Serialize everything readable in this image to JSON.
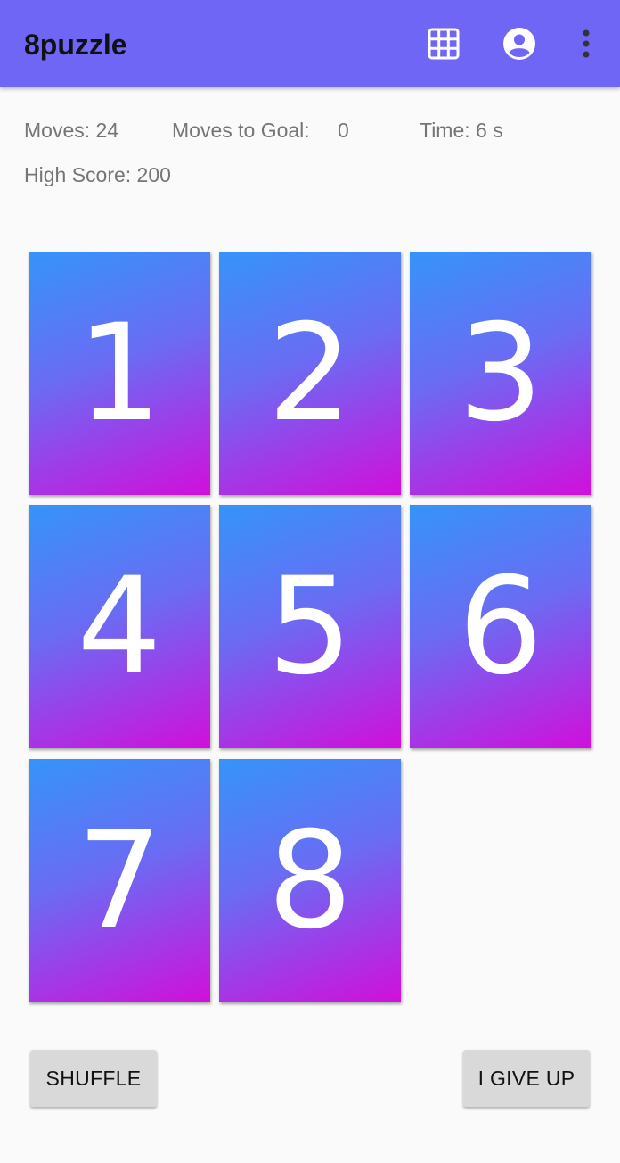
{
  "app": {
    "title": "8puzzle",
    "bar_color": "#6f66f5"
  },
  "toolbar": {
    "grid_icon": "grid-icon",
    "account_icon": "account-circle-icon",
    "menu_icon": "more-vert-icon"
  },
  "stats": {
    "moves": "Moves: 24",
    "moves_to_goal_label": "Moves to Goal:",
    "moves_to_goal_value": "0",
    "time": "Time: 6 s",
    "high_score": "High Score: 200"
  },
  "board": {
    "tiles": [
      "1",
      "2",
      "3",
      "4",
      "5",
      "6",
      "7",
      "8",
      ""
    ],
    "tile_gradient": [
      "#3594f9",
      "#6a6cf4",
      "#d10fdb"
    ]
  },
  "buttons": {
    "shuffle": "SHUFFLE",
    "give_up": "I GIVE UP"
  }
}
